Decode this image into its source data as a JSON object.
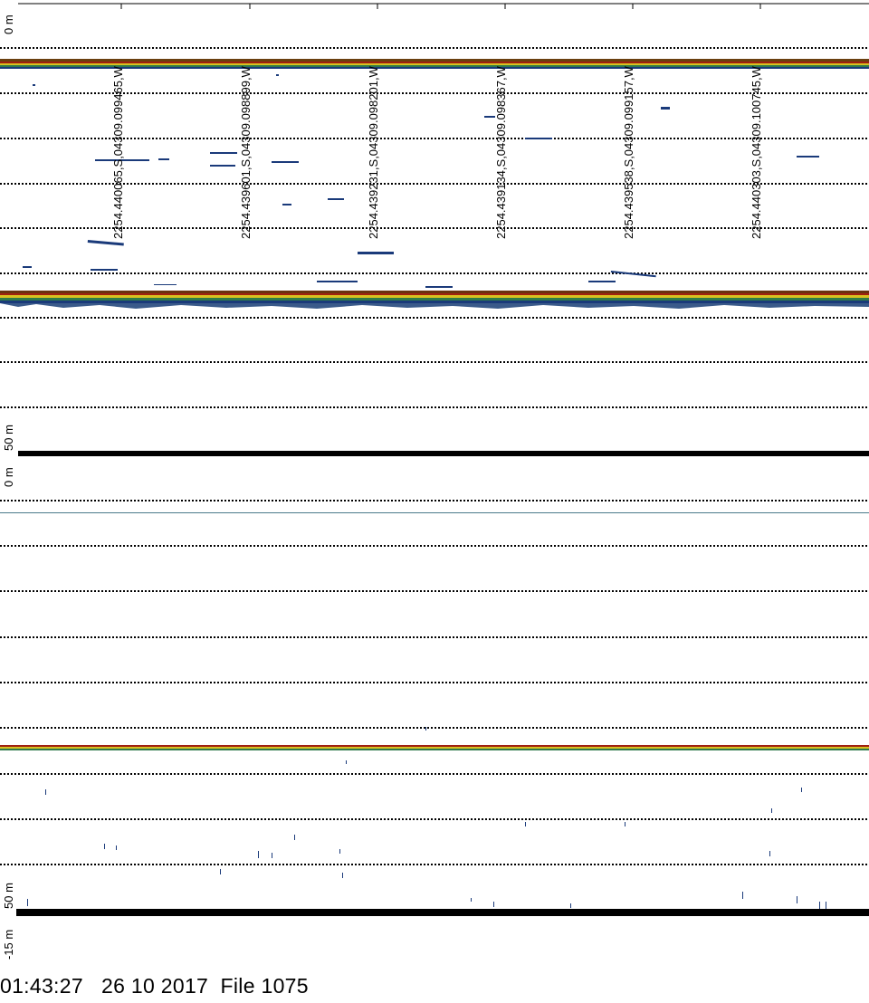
{
  "panel_top": {
    "depth_top_label": "0 m",
    "depth_bottom_label": "50 m"
  },
  "panel_bottom": {
    "depth_top_label": "0 m",
    "depth_bottom_label": "50 m",
    "offset_label": "-15 m"
  },
  "gps_positions": [
    "2254.440065,S,04309.099465,W",
    "2254.439601,S,04309.098899,W",
    "2254.439231,S,04309.098201,W",
    "2254.439134,S,04309.098367,W",
    "2254.439538,S,04309.099157,W",
    "2254.440303,S,04309.100745,W"
  ],
  "footer": {
    "time": "01:43:27",
    "date": "26 10 2017",
    "file": "File 1075"
  },
  "colors": {
    "grid": "#000000",
    "echo_dark": "#1a3a7a",
    "echo_mid": "#2f7a4a",
    "echo_yellow": "#d8c020",
    "echo_red": "#a02010",
    "echo_brown": "#6a4010"
  }
}
